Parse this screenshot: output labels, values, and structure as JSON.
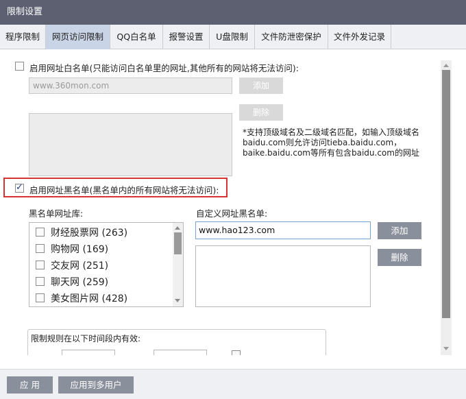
{
  "window": {
    "title": "限制设置"
  },
  "tabs": [
    {
      "label": "程序限制"
    },
    {
      "label": "网页访问限制"
    },
    {
      "label": "QQ白名单"
    },
    {
      "label": "报警设置"
    },
    {
      "label": "U盘限制"
    },
    {
      "label": "文件防泄密保护"
    },
    {
      "label": "文件外发记录"
    }
  ],
  "whitelist": {
    "enable_label": "启用网址白名单(只能访问白名单里的网址,其他所有的网站将无法访问):",
    "enabled": false,
    "url_value": "www.360mon.com",
    "add_label": "添加",
    "delete_label": "删除",
    "note": "*支持顶级域名及二级域名匹配，如输入顶级域名baidu.com则允许访问tieba.baidu.com，baike.baidu.com等所有包含baidu.com的网址"
  },
  "blacklist": {
    "enable_label": "启用网址黑名单(黑名单内的所有网站将无法访问):",
    "enabled": true,
    "library_label": "黑名单网址库:",
    "custom_label": "自定义网址黑名单:",
    "library_items": [
      {
        "label": "财经股票网 (263)",
        "checked": false
      },
      {
        "label": "购物网 (169)",
        "checked": false
      },
      {
        "label": "交友网 (251)",
        "checked": false
      },
      {
        "label": "聊天网 (259)",
        "checked": false
      },
      {
        "label": "美女图片网 (428)",
        "checked": false
      }
    ],
    "custom_input_value": "www.hao123.com",
    "add_label": "添加",
    "delete_label": "删除"
  },
  "schedule": {
    "label": "限制规则在以下时间段内有效:"
  },
  "footer": {
    "apply_label": "应 用",
    "apply_multi_label": "应用到多用户"
  },
  "colors": {
    "titlebar": "#5c6071",
    "active_tab": "#c9d4e6",
    "button": "#8a8f9c",
    "highlight_frame": "#d93030"
  }
}
